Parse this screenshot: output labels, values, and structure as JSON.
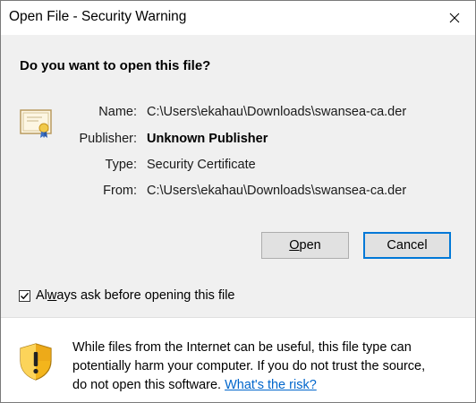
{
  "window": {
    "title": "Open File - Security Warning",
    "close_glyph": "✕"
  },
  "question": "Do you want to open this file?",
  "file_icon": "certificate-icon",
  "details": {
    "name_label": "Name:",
    "name_value": "C:\\Users\\ekahau\\Downloads\\swansea-ca.der",
    "publisher_label": "Publisher:",
    "publisher_value": "Unknown Publisher",
    "type_label": "Type:",
    "type_value": "Security Certificate",
    "from_label": "From:",
    "from_value": "C:\\Users\\ekahau\\Downloads\\swansea-ca.der"
  },
  "buttons": {
    "open_accel": "O",
    "open_rest": "pen",
    "cancel_label": "Cancel"
  },
  "checkbox": {
    "checked": true,
    "label_pre": "Al",
    "label_accel": "w",
    "label_post": "ays ask before opening this file"
  },
  "warning": {
    "icon": "shield-warning-icon",
    "line1": "While files from the Internet can be useful, this file type can",
    "line2": "potentially harm your computer. If you do not trust the source,",
    "line3_prefix": "do not open this software. ",
    "link_text": "What's the risk?"
  },
  "colors": {
    "accent": "#0078d7",
    "link": "#0066cc",
    "shield_yellow": "#f3b51c"
  }
}
